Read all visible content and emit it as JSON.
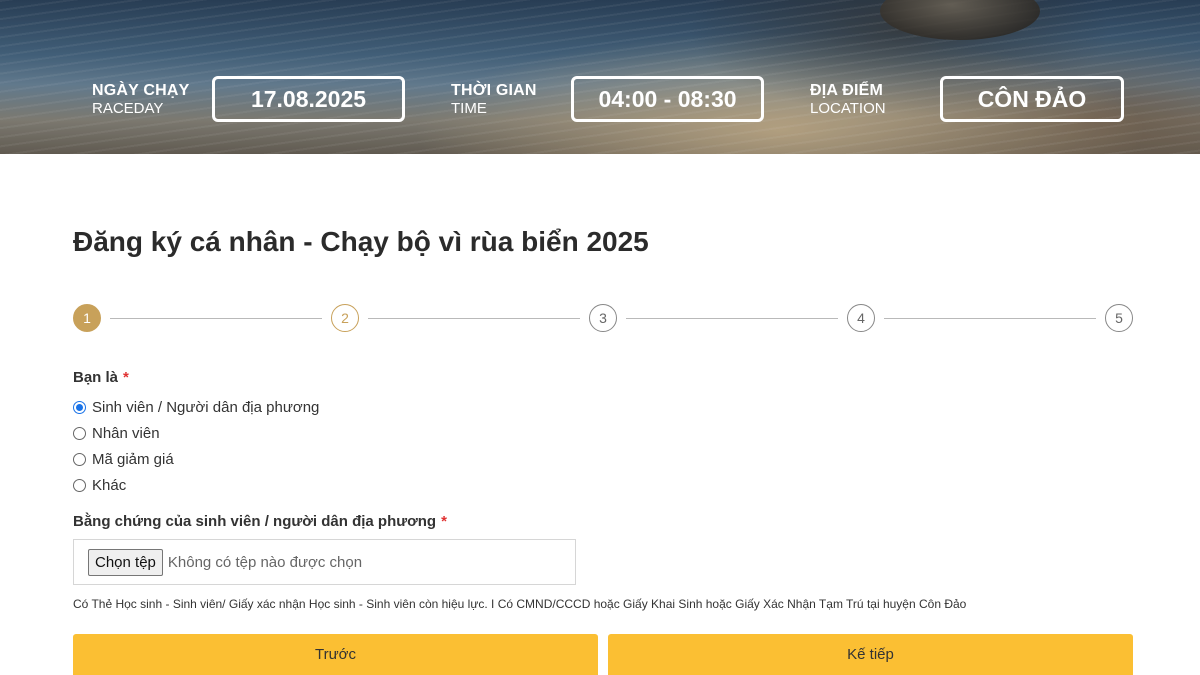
{
  "banner": {
    "raceday": {
      "label_vn": "NGÀY CHẠY",
      "label_en": "RACEDAY",
      "value": "17.08.2025"
    },
    "time": {
      "label_vn": "THỜI GIAN",
      "label_en": "TIME",
      "value": "04:00 - 08:30"
    },
    "location": {
      "label_vn": "ĐỊA ĐIỂM",
      "label_en": "LOCATION",
      "value": "CÔN ĐẢO"
    }
  },
  "form": {
    "title": "Đăng ký cá nhân - Chạy bộ vì rùa biển 2025",
    "steps": [
      "1",
      "2",
      "3",
      "4",
      "5"
    ],
    "current_step": 1,
    "you_are": {
      "label": "Bạn là",
      "required_mark": "*",
      "options": [
        {
          "label": "Sinh viên / Người dân địa phương",
          "checked": true
        },
        {
          "label": "Nhân viên",
          "checked": false
        },
        {
          "label": "Mã giảm giá",
          "checked": false
        },
        {
          "label": "Khác",
          "checked": false
        }
      ]
    },
    "proof": {
      "label": "Bằng chứng của sinh viên / người dân địa phương",
      "required_mark": "*",
      "choose_button": "Chọn tệp",
      "no_file_text": "Không có tệp nào được chọn",
      "hint": "Có Thẻ Học sinh - Sinh viên/ Giấy xác nhận Học sinh - Sinh viên còn hiệu lực. I Có CMND/CCCD hoặc Giấy Khai Sinh hoặc Giấy Xác Nhận Tạm Trú tại huyện Côn Đảo"
    },
    "buttons": {
      "previous": "Trước",
      "next": "Kế tiếp"
    }
  },
  "colors": {
    "accent": "#c8a15a",
    "button": "#fbbf33",
    "radio_checked": "#1a73e8",
    "required": "#e03131"
  }
}
